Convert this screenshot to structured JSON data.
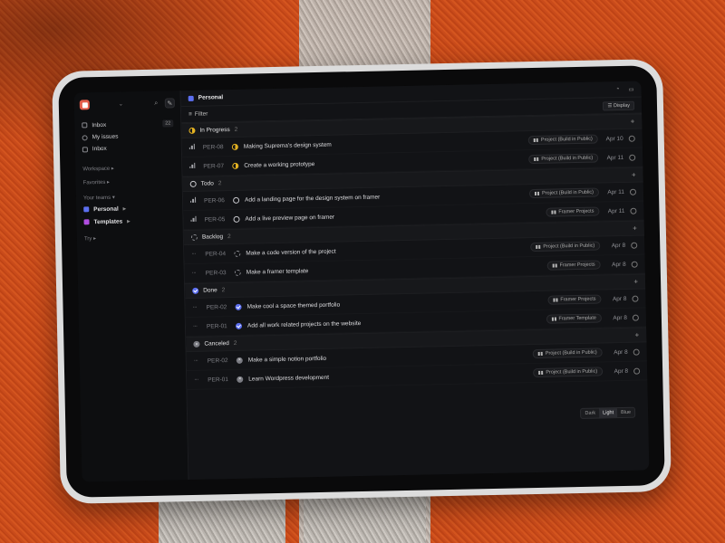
{
  "sidebar": {
    "nav": [
      {
        "label": "Inbox",
        "count": "22"
      },
      {
        "label": "My issues",
        "count": ""
      },
      {
        "label": "Inbox",
        "count": ""
      }
    ],
    "workspace": "Workspace",
    "favorites": "Favorites",
    "your_teams": "Your teams",
    "teams": [
      {
        "label": "Personal",
        "color": "#5c6ff0"
      },
      {
        "label": "Templates",
        "color": "#b04de0"
      }
    ],
    "try": "Try"
  },
  "header": {
    "title": "Personal"
  },
  "filterbar": {
    "filter": "Filter",
    "display": "Display"
  },
  "groups": [
    {
      "name": "In Progress",
      "count": "2",
      "status": "prog",
      "rows": [
        {
          "id": "PER-08",
          "title": "Making Suprema's design system",
          "project": "Project (Build in Public)",
          "date": "Apr 10"
        },
        {
          "id": "PER-07",
          "title": "Create a working prototype",
          "project": "Project (Build in Public)",
          "date": "Apr 11"
        }
      ]
    },
    {
      "name": "Todo",
      "count": "2",
      "status": "todo",
      "rows": [
        {
          "id": "PER-06",
          "title": "Add a landing page for the design system on framer",
          "project": "Project (Build in Public)",
          "date": "Apr 11"
        },
        {
          "id": "PER-05",
          "title": "Add a live preview page on framer",
          "project": "Framer Projects",
          "date": "Apr 11"
        }
      ]
    },
    {
      "name": "Backlog",
      "count": "2",
      "status": "back",
      "rows": [
        {
          "id": "PER-04",
          "title": "Make a code version of the project",
          "project": "Project (Build in Public)",
          "date": "Apr 8"
        },
        {
          "id": "PER-03",
          "title": "Make a framer template",
          "project": "Framer Projects",
          "date": "Apr 8"
        }
      ]
    },
    {
      "name": "Done",
      "count": "2",
      "status": "done",
      "rows": [
        {
          "id": "PER-02",
          "title": "Make cool a space themed portfolio",
          "project": "Framer Projects",
          "date": "Apr 8"
        },
        {
          "id": "PER-01",
          "title": "Add all work related projects on the website",
          "project": "Framer Template",
          "date": "Apr 8"
        }
      ]
    },
    {
      "name": "Canceled",
      "count": "2",
      "status": "cancel",
      "rows": [
        {
          "id": "PER-02",
          "title": "Make a simple notion portfolio",
          "project": "Project (Build in Public)",
          "date": "Apr 8"
        },
        {
          "id": "PER-01",
          "title": "Learn Wordpress development",
          "project": "Project (Build in Public)",
          "date": "Apr 8"
        }
      ]
    }
  ],
  "theme": {
    "options": [
      "Dark",
      "Light",
      "Blue"
    ],
    "selected": "Light"
  }
}
